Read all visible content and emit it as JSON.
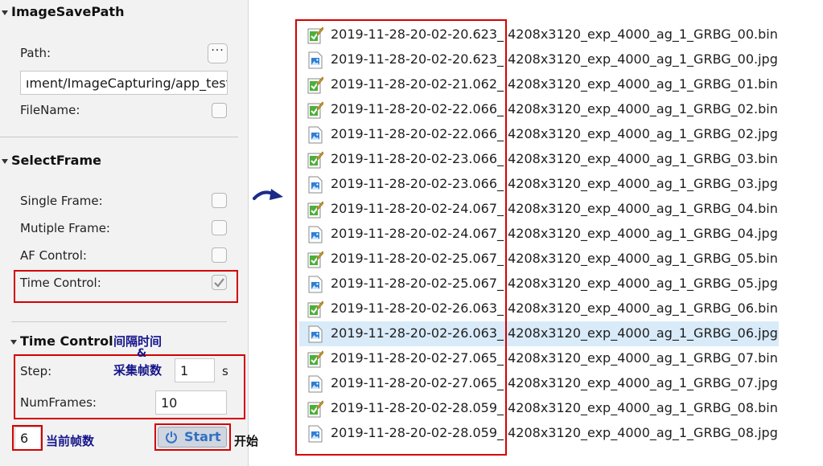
{
  "left_panel": {
    "image_save_path": {
      "title": "ImageSavePath",
      "path_label": "Path:",
      "browse_label": "···",
      "path_value": "ıment/ImageCapturing/app_test",
      "filename_label": "FileName:"
    },
    "select_frame": {
      "title": "SelectFrame",
      "single_frame_label": "Single Frame:",
      "multiple_frame_label": "Mutiple Frame:",
      "af_control_label": "AF Control:",
      "time_control_label": "Time Control:",
      "time_control_checked": true
    },
    "time_control": {
      "title": "Time Control",
      "step_label": "Step:",
      "step_value": "1",
      "step_unit": "s",
      "numframes_label": "NumFrames:",
      "numframes_value": "10"
    },
    "current_frame_value": "6",
    "start_label": "Start"
  },
  "annotations": {
    "interval_time": "间隔时间",
    "ampersand": "&",
    "capture_frames": "采集帧数",
    "current_frames": "当前帧数",
    "start": "开始"
  },
  "arrow_icon": "curved-arrow-icon",
  "colors": {
    "annotation_red": "#d40000",
    "annotation_blue": "#15158a",
    "selected_row": "#d9ebf9",
    "start_text": "#3270c4"
  },
  "files": [
    {
      "name": "2019-11-28-20-02-20.623_ 4208x3120_exp_4000_ag_1_GRBG_00.bin",
      "type": "bin"
    },
    {
      "name": "2019-11-28-20-02-20.623_ 4208x3120_exp_4000_ag_1_GRBG_00.jpg",
      "type": "jpg"
    },
    {
      "name": "2019-11-28-20-02-21.062_ 4208x3120_exp_4000_ag_1_GRBG_01.bin",
      "type": "bin"
    },
    {
      "name": "2019-11-28-20-02-22.066_ 4208x3120_exp_4000_ag_1_GRBG_02.bin",
      "type": "bin"
    },
    {
      "name": "2019-11-28-20-02-22.066_ 4208x3120_exp_4000_ag_1_GRBG_02.jpg",
      "type": "jpg"
    },
    {
      "name": "2019-11-28-20-02-23.066_ 4208x3120_exp_4000_ag_1_GRBG_03.bin",
      "type": "bin"
    },
    {
      "name": "2019-11-28-20-02-23.066_ 4208x3120_exp_4000_ag_1_GRBG_03.jpg",
      "type": "jpg"
    },
    {
      "name": "2019-11-28-20-02-24.067_ 4208x3120_exp_4000_ag_1_GRBG_04.bin",
      "type": "bin"
    },
    {
      "name": "2019-11-28-20-02-24.067_ 4208x3120_exp_4000_ag_1_GRBG_04.jpg",
      "type": "jpg"
    },
    {
      "name": "2019-11-28-20-02-25.067_ 4208x3120_exp_4000_ag_1_GRBG_05.bin",
      "type": "bin"
    },
    {
      "name": "2019-11-28-20-02-25.067_ 4208x3120_exp_4000_ag_1_GRBG_05.jpg",
      "type": "jpg"
    },
    {
      "name": "2019-11-28-20-02-26.063_ 4208x3120_exp_4000_ag_1_GRBG_06.bin",
      "type": "bin"
    },
    {
      "name": "2019-11-28-20-02-26.063_ 4208x3120_exp_4000_ag_1_GRBG_06.jpg",
      "type": "jpg",
      "selected": true
    },
    {
      "name": "2019-11-28-20-02-27.065_ 4208x3120_exp_4000_ag_1_GRBG_07.bin",
      "type": "bin"
    },
    {
      "name": "2019-11-28-20-02-27.065_ 4208x3120_exp_4000_ag_1_GRBG_07.jpg",
      "type": "jpg"
    },
    {
      "name": "2019-11-28-20-02-28.059_ 4208x3120_exp_4000_ag_1_GRBG_08.bin",
      "type": "bin"
    },
    {
      "name": "2019-11-28-20-02-28.059_ 4208x3120_exp_4000_ag_1_GRBG_08.jpg",
      "type": "jpg"
    }
  ]
}
